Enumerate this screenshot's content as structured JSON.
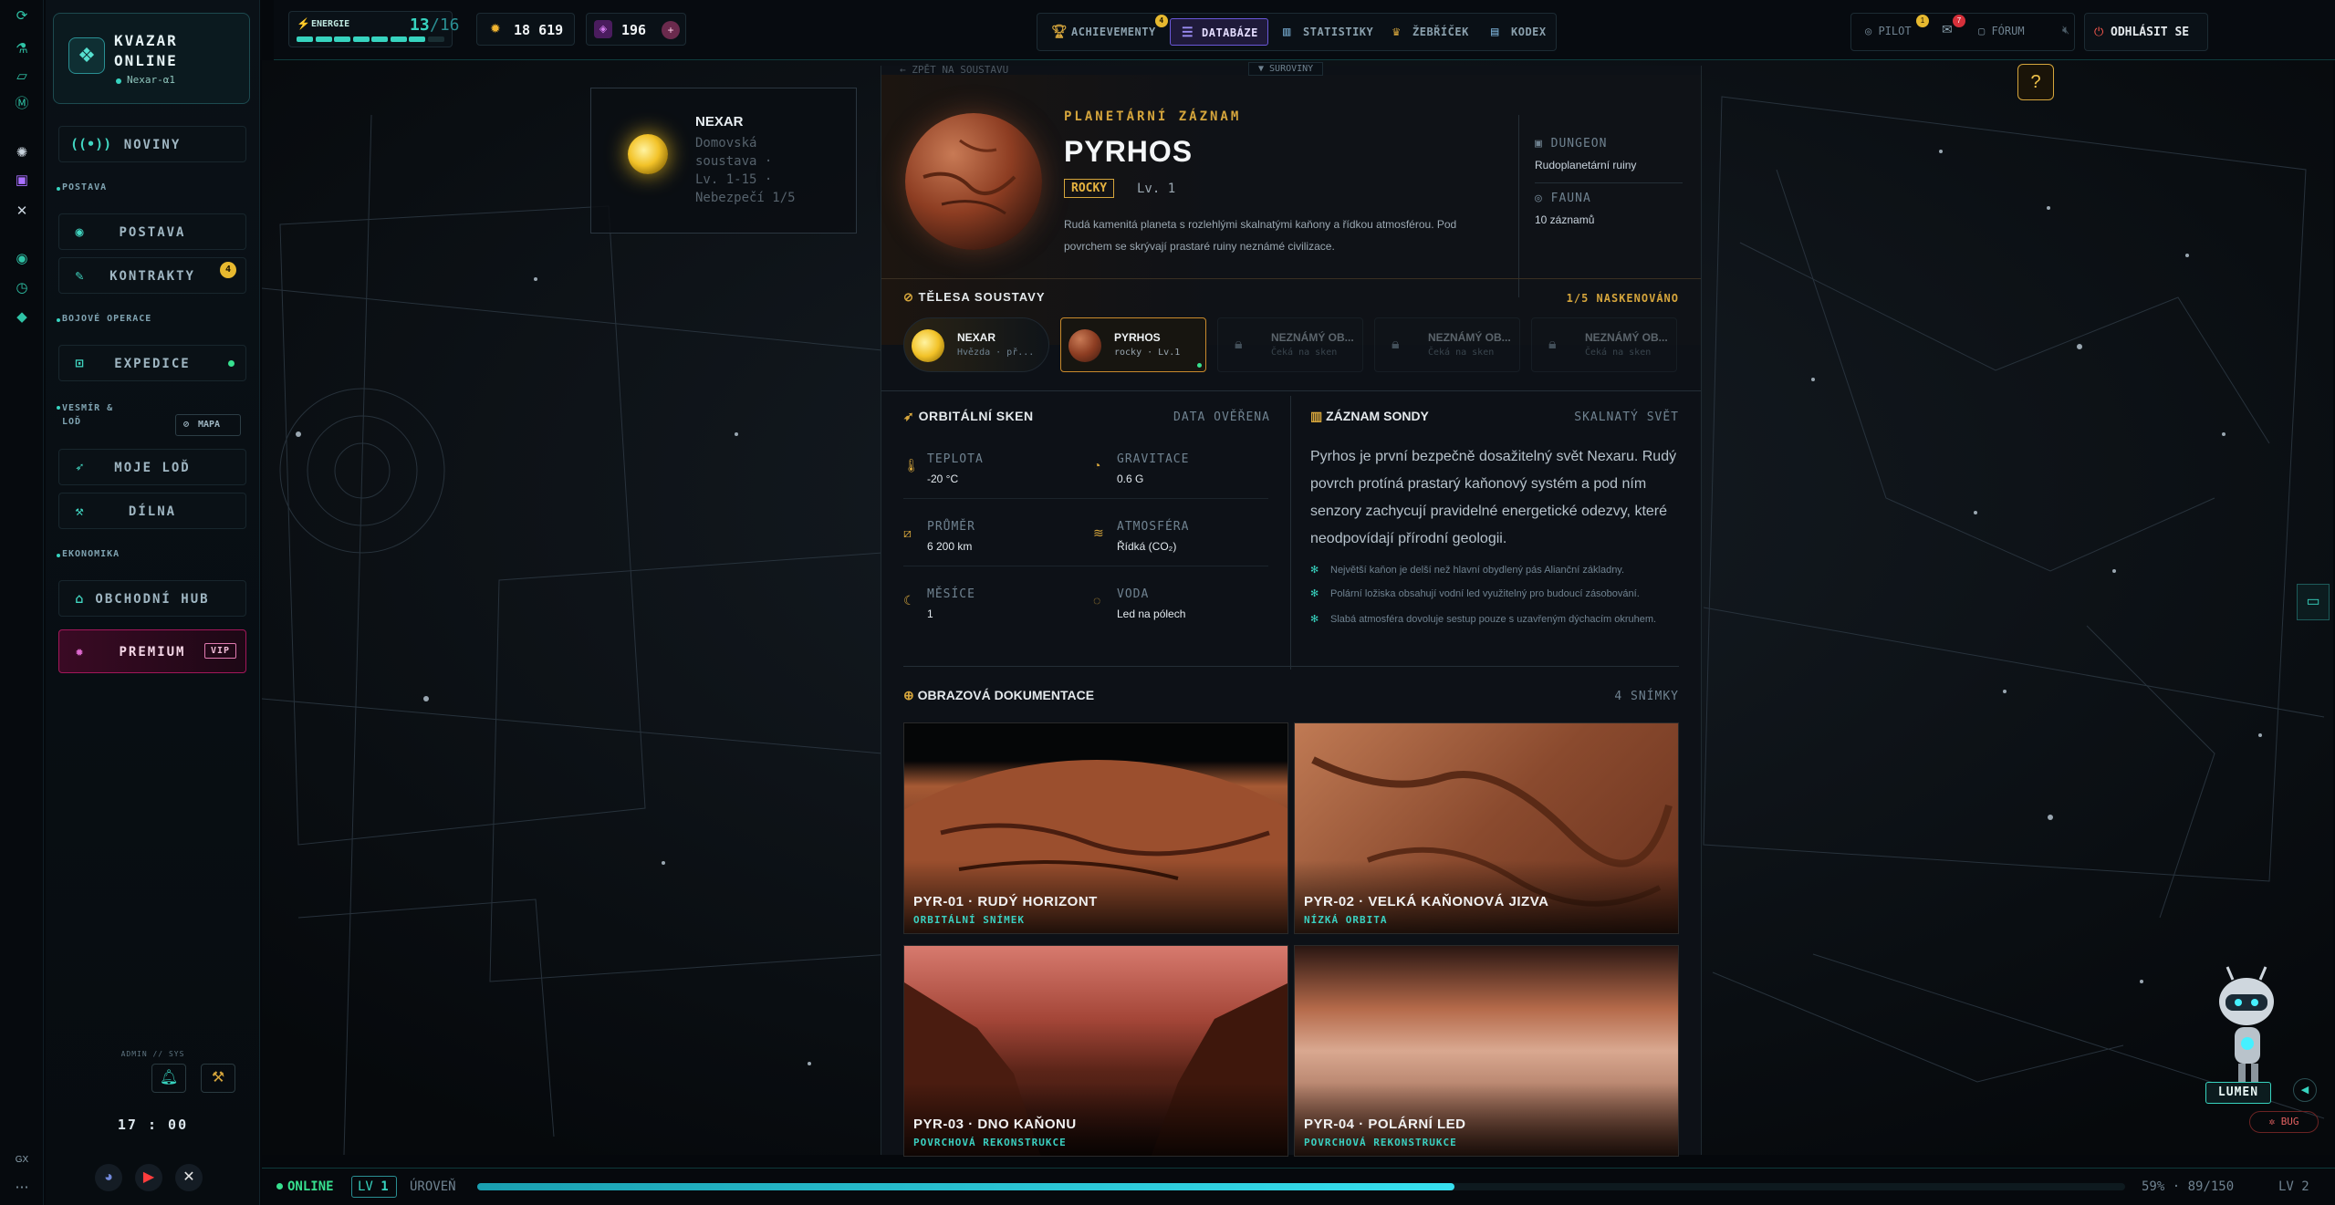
{
  "app": {
    "name_line1": "KVAZAR",
    "name_line2": "ONLINE",
    "server": "Nexar-α1"
  },
  "sidebar": {
    "items": [
      {
        "label": "NOVINY"
      },
      {
        "section": "POSTAVA"
      },
      {
        "label": "POSTAVA"
      },
      {
        "label": "KONTRAKTY",
        "badge": "4"
      },
      {
        "section": "BOJOVÉ OPERACE"
      },
      {
        "label": "EXPEDICE"
      },
      {
        "section": "VESMÍR & LOĎ",
        "action": "MAPA"
      },
      {
        "label": "MOJE LOĎ"
      },
      {
        "label": "DÍLNA"
      },
      {
        "section": "EKONOMIKA"
      },
      {
        "label": "OBCHODNÍ HUB"
      },
      {
        "label": "PREMIUM",
        "badge": "VIP"
      }
    ],
    "admin_label": "ADMIN // SYS",
    "clock": "17 : 00",
    "rail_label": "GX"
  },
  "topbar": {
    "energy_label": "ENERGIE",
    "energy_value": "13",
    "energy_max": "/16",
    "energy_fraction": 0.8125,
    "credits": "18 619",
    "gems": "196",
    "tabs": [
      {
        "label": "ACHIEVEMENTY",
        "badge": "4"
      },
      {
        "label": "DATABÁZE",
        "active": true
      },
      {
        "label": "STATISTIKY"
      },
      {
        "label": "ŽEBŘÍČEK"
      },
      {
        "label": "KODEX"
      }
    ],
    "pilot_label": "PILOT",
    "pilot_badge": "1",
    "mail_badge": "7",
    "forum_label": "FÓRUM",
    "lang": "CS",
    "logout_label": "ODHLÁSIT SE",
    "dropdown_hint": "▼ SUROVINY"
  },
  "system_card": {
    "name": "NEXAR",
    "desc": [
      "Domovská",
      "soustava ·",
      "Lv. 1-15 ·",
      "Nebezpečí 1/5"
    ]
  },
  "record": {
    "back_label": "← ZPĚT NA SOUSTAVU",
    "kicker": "PLANETÁRNÍ ZÁZNAM",
    "name": "PYRHOS",
    "type": "ROCKY",
    "level": "Lv. 1",
    "description": "Rudá kamenitá planeta s rozlehlými skalnatými kaňony a řídkou atmosférou. Pod povrchem se skrývají prastaré ruiny neznámé civilizace.",
    "dungeon_label": "DUNGEON",
    "dungeon_value": "Rudoplanetární ruiny",
    "fauna_label": "FAUNA",
    "fauna_value": "10 záznamů"
  },
  "bodies": {
    "title": "TĚLESA SOUSTAVY",
    "scanned": "1/5 NASKENOVÁNO",
    "items": [
      {
        "name": "NEXAR",
        "sub": "Hvězda · př..."
      },
      {
        "name": "PYRHOS",
        "sub": "rocky · Lv.1"
      },
      {
        "name": "NEZNÁMÝ OB...",
        "sub": "Čeká na sken"
      },
      {
        "name": "NEZNÁMÝ OB...",
        "sub": "Čeká na sken"
      },
      {
        "name": "NEZNÁMÝ OB...",
        "sub": "Čeká na sken"
      }
    ]
  },
  "scan": {
    "title": "ORBITÁLNÍ SKEN",
    "status": "DATA OVĚŘENA",
    "stats": [
      {
        "label": "TEPLOTA",
        "value": "-20 °C"
      },
      {
        "label": "GRAVITACE",
        "value": "0.6 G"
      },
      {
        "label": "PRŮMĚR",
        "value": "6 200 km"
      },
      {
        "label": "ATMOSFÉRA",
        "value": "Řídká (CO₂)"
      },
      {
        "label": "MĚSÍCE",
        "value": "1"
      },
      {
        "label": "VODA",
        "value": "Led na pólech"
      }
    ]
  },
  "probe": {
    "title": "ZÁZNAM SONDY",
    "tag": "SKALNATÝ SVĚT",
    "text": "Pyrhos je první bezpečně dosažitelný svět Nexaru. Rudý povrch protíná prastarý kaňonový systém a pod ním senzory zachycují pravidelné energetické odezvy, které neodpovídají přírodní geologii.",
    "notes": [
      "Největší kaňon je delší než hlavní obydlený pás Alianční základny.",
      "Polární ložiska obsahují vodní led využitelný pro budoucí zásobování.",
      "Slabá atmosféra dovoluje sestup pouze s uzavřeným dýchacím okruhem."
    ]
  },
  "gallery": {
    "title": "OBRAZOVÁ DOKUMENTACE",
    "count": "4 SNÍMKY",
    "photos": [
      {
        "title": "PYR-01 · RUDÝ HORIZONT",
        "sub": "ORBITÁLNÍ SNÍMEK"
      },
      {
        "title": "PYR-02 · VELKÁ KAŇONOVÁ JIZVA",
        "sub": "NÍZKÁ ORBITA"
      },
      {
        "title": "PYR-03 · DNO KAŇONU",
        "sub": "POVRCHOVÁ REKONSTRUKCE"
      },
      {
        "title": "PYR-04 · POLÁRNÍ LED",
        "sub": "POVRCHOVÁ REKONSTRUKCE"
      }
    ]
  },
  "assistant": {
    "name": "LUMEN",
    "bug_label": "BUG"
  },
  "status": {
    "online": "ONLINE",
    "level_badge": "LV",
    "level_value": "1",
    "level_label": "ÚROVEŇ",
    "xp_percent": "59%",
    "xp_fraction": 0.5933,
    "xp_text": "89/150",
    "next_level": "LV 2"
  },
  "colors": {
    "accent": "#37d3bf",
    "gold": "#d5a53c",
    "premium": "#c2185b",
    "panel": "#0d1117"
  }
}
